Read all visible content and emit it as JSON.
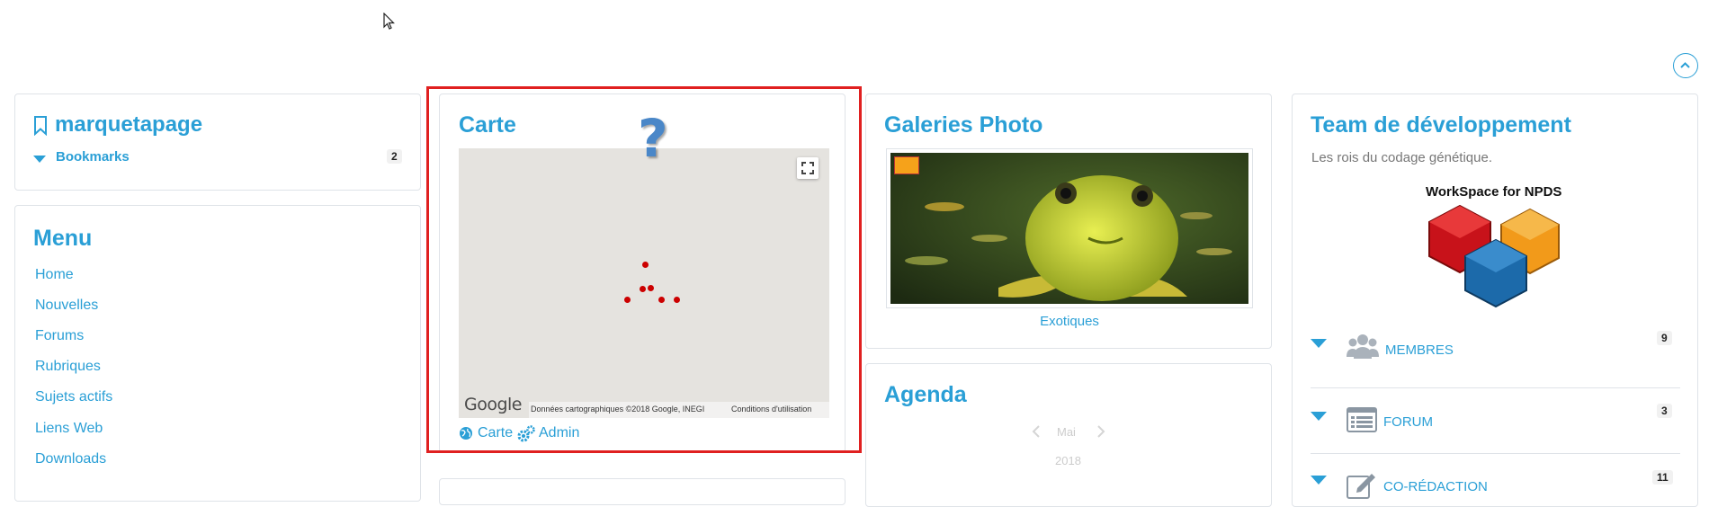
{
  "bookmark_card": {
    "title": "marquetapage",
    "bookmarks_label": "Bookmarks",
    "bookmarks_count": "2"
  },
  "menu_card": {
    "title": "Menu",
    "items": [
      "Home",
      "Nouvelles",
      "Forums",
      "Rubriques",
      "Sujets actifs",
      "Liens Web",
      "Downloads"
    ]
  },
  "map_card": {
    "title": "Carte",
    "question_mark": "?",
    "google_logo": "Google",
    "attribution": "Données cartographiques ©2018 Google, INEGI",
    "terms": "Conditions d'utilisation",
    "carte_link": "Carte",
    "admin_link": "Admin"
  },
  "gallery_card": {
    "title": "Galeries Photo",
    "caption": "Exotiques"
  },
  "agenda_card": {
    "title": "Agenda",
    "month": "Mai",
    "year": "2018"
  },
  "team_card": {
    "title": "Team de développement",
    "subtitle": "Les rois du codage génétique.",
    "logo_text": "WorkSpace for NPDS",
    "groups": [
      {
        "label": "MEMBRES",
        "count": "9",
        "icon": "users-icon"
      },
      {
        "label": "FORUM",
        "count": "3",
        "icon": "list-icon"
      },
      {
        "label": "CO-RÉDACTION",
        "count": "11",
        "icon": "edit-icon"
      }
    ]
  },
  "colors": {
    "accent": "#2a9fd6",
    "highlight": "#e02020",
    "map_bg": "#e5e3df",
    "marker": "#cc0000"
  }
}
